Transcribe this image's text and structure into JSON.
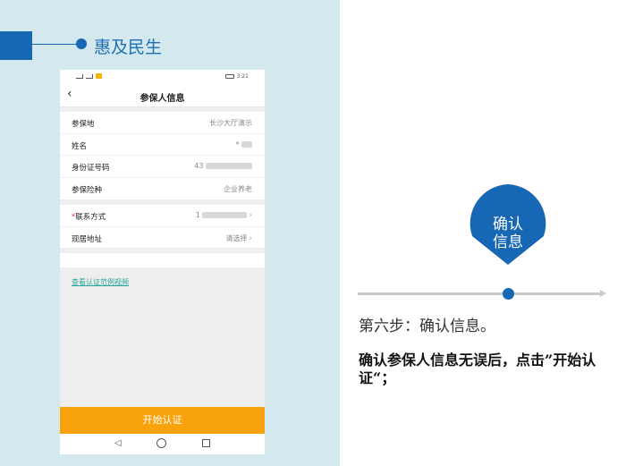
{
  "header": {
    "title": "惠及民生"
  },
  "phone": {
    "status": {
      "left": "⚿ HD 4G",
      "time": "3:21"
    },
    "nav": {
      "title": "参保人信息"
    },
    "section1": [
      {
        "label": "参保地",
        "value": "长沙大厅演示"
      },
      {
        "label": "姓名",
        "value": "*"
      },
      {
        "label": "身份证号码",
        "value": "43"
      },
      {
        "label": "参保险种",
        "value": "企业养老"
      }
    ],
    "section2": [
      {
        "label": "联系方式",
        "required_mark": "*",
        "value": "1"
      },
      {
        "label": "现居地址",
        "value": "请选择"
      }
    ],
    "video_link": "查看认证范例视频",
    "start_button": "开始认证"
  },
  "step": {
    "badge_line1": "确认",
    "badge_line2": "信息",
    "title": "第六步：确认信息。",
    "description": "确认参保人信息无误后，点击”开始认证“；"
  },
  "colors": {
    "brand_blue": "#1668b4",
    "button_orange": "#f8a30e",
    "panel_bg": "#d4e9ee",
    "link_teal": "#2aa59a"
  }
}
